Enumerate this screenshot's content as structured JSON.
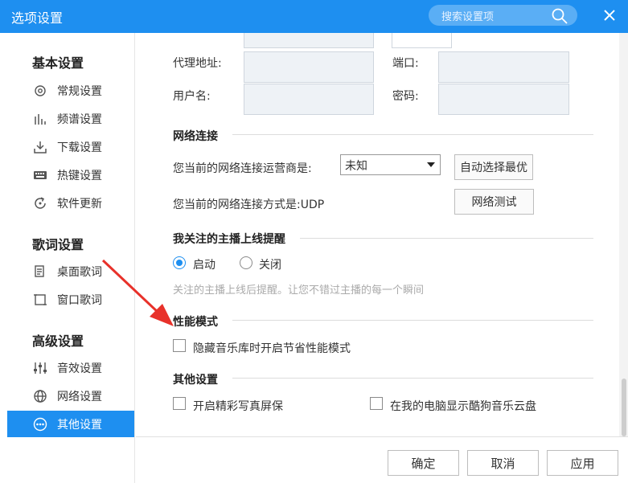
{
  "window": {
    "title": "选项设置"
  },
  "search": {
    "placeholder": "搜索设置项"
  },
  "sidebar": {
    "sections": [
      {
        "title": "基本设置",
        "items": [
          {
            "label": "常规设置",
            "icon": "gear-icon"
          },
          {
            "label": "频谱设置",
            "icon": "spectrum-icon"
          },
          {
            "label": "下载设置",
            "icon": "download-icon"
          },
          {
            "label": "热键设置",
            "icon": "keyboard-icon"
          },
          {
            "label": "软件更新",
            "icon": "update-icon"
          }
        ]
      },
      {
        "title": "歌词设置",
        "items": [
          {
            "label": "桌面歌词",
            "icon": "desktop-lyrics-icon"
          },
          {
            "label": "窗口歌词",
            "icon": "window-lyrics-icon"
          }
        ]
      },
      {
        "title": "高级设置",
        "items": [
          {
            "label": "音效设置",
            "icon": "equalizer-icon"
          },
          {
            "label": "网络设置",
            "icon": "globe-icon"
          },
          {
            "label": "其他设置",
            "icon": "more-icon",
            "active": true
          }
        ]
      }
    ]
  },
  "proxy": {
    "address_label": "代理地址:",
    "port_label": "端口:",
    "username_label": "用户名:",
    "password_label": "密码:"
  },
  "network": {
    "heading": "网络连接",
    "carrier_label": "您当前的网络连接运营商是:",
    "carrier_value": "未知",
    "auto_select_button": "自动选择最优",
    "mode_label": "您当前的网络连接方式是:UDP",
    "test_button": "网络测试"
  },
  "anchor_alert": {
    "heading": "我关注的主播上线提醒",
    "on_label": "启动",
    "off_label": "关闭",
    "hint": "关注的主播上线后提醒。让您不错过主播的每一个瞬间"
  },
  "performance": {
    "heading": "性能模式",
    "option_label": "隐藏音乐库时开启节省性能模式"
  },
  "other": {
    "heading": "其他设置",
    "screensaver_label": "开启精彩写真屏保",
    "cloud_disk_label": "在我的电脑显示酷狗音乐云盘"
  },
  "footer": {
    "ok": "确定",
    "cancel": "取消",
    "apply": "应用"
  },
  "colors": {
    "accent": "#1e8ff0",
    "annotation_arrow": "#e8312a"
  }
}
